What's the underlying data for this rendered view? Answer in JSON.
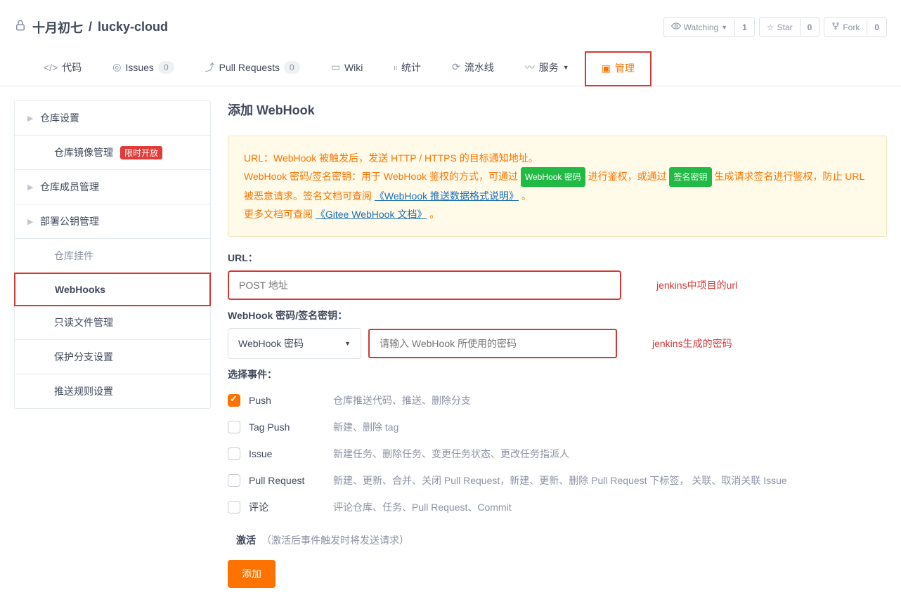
{
  "repo": {
    "owner": "十月初七",
    "name": "lucky-cloud"
  },
  "actions": {
    "watch": {
      "label": "Watching",
      "count": "1"
    },
    "star": {
      "label": "Star",
      "count": "0"
    },
    "fork": {
      "label": "Fork",
      "count": "0"
    }
  },
  "tabs": {
    "code": "代码",
    "issues": {
      "label": "Issues",
      "count": "0"
    },
    "pr": {
      "label": "Pull Requests",
      "count": "0"
    },
    "wiki": "Wiki",
    "stats": "统计",
    "pipeline": "流水线",
    "services": "服务",
    "admin": "管理"
  },
  "sidebar": {
    "repo_settings": "仓库设置",
    "mirror": {
      "label": "仓库镜像管理",
      "pill": "限时开放"
    },
    "members": "仓库成员管理",
    "deploy_keys": "部署公钥管理",
    "plugins": "仓库挂件",
    "webhooks": "WebHooks",
    "readonly": "只读文件管理",
    "protected": "保护分支设置",
    "push_rules": "推送规则设置"
  },
  "page": {
    "title": "添加 WebHook"
  },
  "infobox": {
    "line1": "URL：WebHook 被触发后，发送 HTTP / HTTPS 的目标通知地址。",
    "line2a": "WebHook 密码/签名密钥：用于 WebHook 鉴权的方式，可通过 ",
    "chip_pwd": "WebHook 密码",
    "line2b": " 进行鉴权，或通过 ",
    "chip_sign": "签名密钥",
    "line2c": " 生成请求签名进行鉴权，防止 URL 被恶意请求。签名文档可查阅 ",
    "link1": "《WebHook 推送数据格式说明》",
    "line2d": " 。",
    "line3a": "更多文档可查阅 ",
    "link2": "《Gitee WebHook 文档》",
    "line3b": " 。"
  },
  "form": {
    "url_label": "URL：",
    "url_placeholder": "POST 地址",
    "url_annot": "jenkins中项目的url",
    "secret_label": "WebHook 密码/签名密钥：",
    "secret_select": "WebHook 密码",
    "secret_placeholder": "请输入 WebHook 所使用的密码",
    "secret_annot": "jenkins生成的密码",
    "events_label": "选择事件：",
    "events": [
      {
        "name": "Push",
        "desc": "仓库推送代码、推送、删除分支",
        "checked": true
      },
      {
        "name": "Tag Push",
        "desc": "新建、删除 tag",
        "checked": false
      },
      {
        "name": "Issue",
        "desc": "新建任务、删除任务、变更任务状态、更改任务指派人",
        "checked": false
      },
      {
        "name": "Pull Request",
        "desc": "新建、更新、合并、关闭 Pull Request，新建、更新、删除 Pull Request 下标签， 关联、取消关联 Issue",
        "checked": false
      },
      {
        "name": "评论",
        "desc": "评论仓库、任务、Pull Request、Commit",
        "checked": false
      }
    ],
    "activate": {
      "label": "激活",
      "hint": "（激活后事件触发时将发送请求）",
      "checked": true
    },
    "submit": "添加"
  }
}
